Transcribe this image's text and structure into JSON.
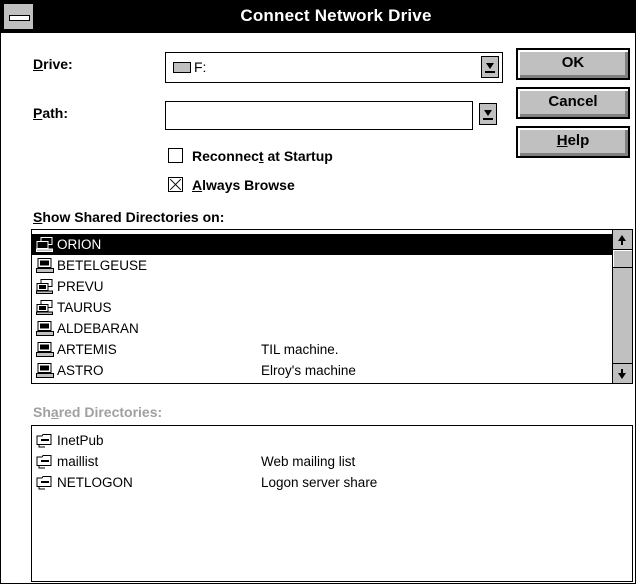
{
  "window": {
    "title": "Connect Network Drive"
  },
  "drive": {
    "label_prefix": "D",
    "label_rest": "rive:",
    "value": "F:"
  },
  "path": {
    "label_prefix": "P",
    "label_rest": "ath:",
    "value": ""
  },
  "buttons": {
    "ok": "OK",
    "cancel": "Cancel",
    "help_prefix": "H",
    "help_rest": "elp"
  },
  "options": {
    "reconnect": {
      "label_a": "Reconnec",
      "label_u": "t",
      "label_b": " at Startup",
      "checked": false
    },
    "always_browse": {
      "label_u": "A",
      "label_b": "lways Browse",
      "checked": true
    }
  },
  "shared_on": {
    "label_prefix": "S",
    "label_rest": "how Shared Directories on:",
    "items": [
      {
        "name": "ORION",
        "comment": "",
        "icon": "network-group-icon",
        "selected": true
      },
      {
        "name": "BETELGEUSE",
        "comment": "",
        "icon": "computer-icon"
      },
      {
        "name": "PREVU",
        "comment": "",
        "icon": "network-group-icon"
      },
      {
        "name": "TAURUS",
        "comment": "",
        "icon": "network-group-icon"
      },
      {
        "name": "ALDEBARAN",
        "comment": "",
        "icon": "computer-icon"
      },
      {
        "name": "ARTEMIS",
        "comment": "TIL machine.",
        "icon": "computer-icon"
      },
      {
        "name": "ASTRO",
        "comment": "Elroy's machine",
        "icon": "computer-icon"
      }
    ]
  },
  "shared_dirs": {
    "label_a": "Sh",
    "label_u": "a",
    "label_b": "red Directories:",
    "items": [
      {
        "name": "InetPub",
        "comment": "",
        "icon": "shared-folder-icon"
      },
      {
        "name": "maillist",
        "comment": "Web mailing list",
        "icon": "shared-folder-icon"
      },
      {
        "name": "NETLOGON",
        "comment": "Logon server share",
        "icon": "shared-folder-icon"
      }
    ]
  }
}
